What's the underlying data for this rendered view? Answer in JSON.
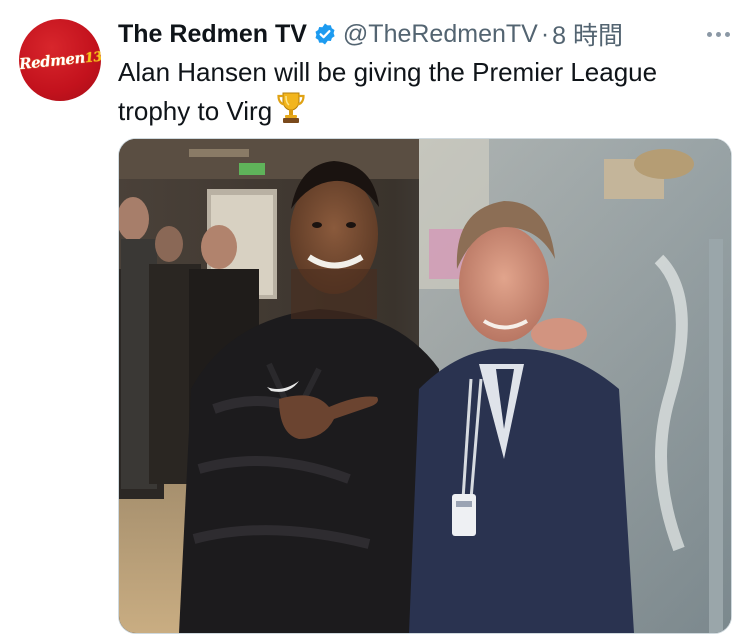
{
  "tweet": {
    "avatar_logo_text": "Redmen",
    "avatar_logo_num": "13",
    "display_name": "The Redmen TV",
    "handle": "@TheRedmenTV",
    "separator": "·",
    "time": "8 時間",
    "text": "Alan Hansen will be giving the Premier League trophy to Virg",
    "emoji_icon": "trophy-icon"
  },
  "icons": {
    "verified": "verified-badge-icon",
    "more": "more-options-icon"
  },
  "colors": {
    "verified": "#1d9bf0",
    "avatar": "#c3121d",
    "secondary_text": "#536471"
  }
}
